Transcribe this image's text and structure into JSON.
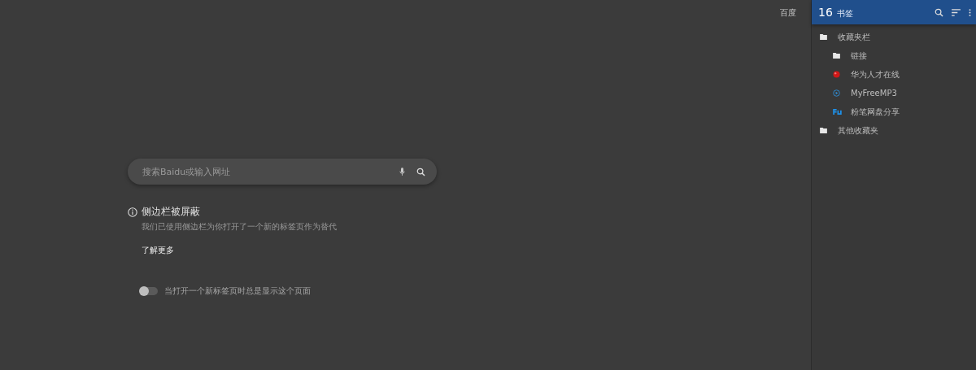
{
  "top_link": "百度",
  "search": {
    "placeholder": "搜索Baidu或输入网址"
  },
  "notice": {
    "title": "侧边栏被屏蔽",
    "message": "我们已使用侧边栏为你打开了一个新的标签页作为替代",
    "link": "了解更多"
  },
  "toggle": {
    "label": "当打开一个新标签页时总是显示这个页面",
    "on": false
  },
  "sidebar": {
    "count": "16",
    "title": "书签",
    "items": [
      {
        "label": "收藏夹栏",
        "kind": "folder",
        "children": [
          {
            "label": "链接",
            "kind": "folder"
          },
          {
            "label": "华为人才在线",
            "kind": "red-ball"
          },
          {
            "label": "MyFreeMP3",
            "kind": "play-circle"
          },
          {
            "label": "粉笔网盘分享",
            "kind": "blue-logo"
          }
        ]
      },
      {
        "label": "其他收藏夹",
        "kind": "folder"
      }
    ]
  }
}
